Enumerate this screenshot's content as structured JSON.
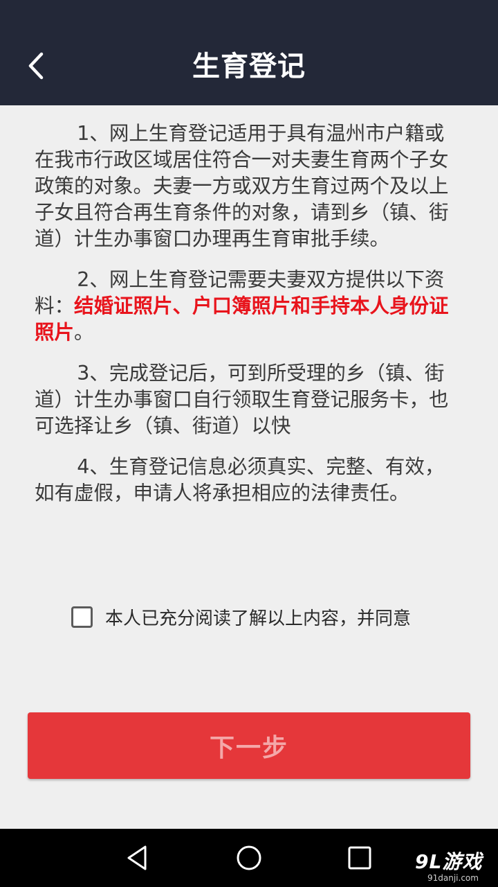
{
  "header": {
    "title": "生育登记"
  },
  "content": {
    "paragraphs": [
      {
        "text": "1、网上生育登记适用于具有温州市户籍或在我市行政区域居住符合一对夫妻生育两个子女政策的对象。夫妻一方或双方生育过两个及以上子女且符合再生育条件的对象，请到乡（镇、街道）计生办事窗口办理再生育审批手续。"
      },
      {
        "prefix": "2、网上生育登记需要夫妻双方提供以下资料：",
        "highlight": "结婚证照片、户口簿照片和手持本人身份证照片",
        "suffix": "。"
      },
      {
        "text": "3、完成登记后，可到所受理的乡（镇、街道）计生办事窗口自行领取生育登记服务卡，也可选择让乡（镇、街道）以快"
      },
      {
        "text": "4、生育登记信息必须真实、完整、有效，如有虚假，申请人将承担相应的法律责任。"
      }
    ]
  },
  "agreement": {
    "label": "本人已充分阅读了解以上内容，并同意"
  },
  "next_button": {
    "label": "下一步"
  },
  "watermark": {
    "brand": "9L游戏",
    "site": "91danji.com"
  },
  "colors": {
    "header_bg": "#232838",
    "highlight": "#e8141c",
    "button_bg": "#e5373a",
    "button_text": "#f4a7a8"
  }
}
